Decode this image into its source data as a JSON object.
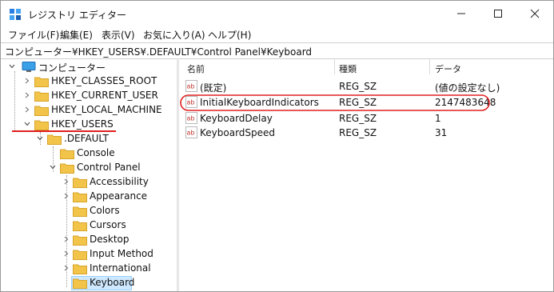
{
  "window": {
    "title": "レジストリ エディター"
  },
  "menu": [
    "ファイル(F)",
    "編集(E)",
    "表示(V)",
    "お気に入り(A)",
    "ヘルプ(H)"
  ],
  "address_bar": {
    "path": "コンピューター¥HKEY_USERS¥.DEFAULT¥Control Panel¥Keyboard"
  },
  "tree": {
    "root": "コンピューター",
    "hives": [
      "HKEY_CLASSES_ROOT",
      "HKEY_CURRENT_USER",
      "HKEY_LOCAL_MACHINE",
      "HKEY_USERS"
    ],
    "users_child": ".DEFAULT",
    "default_children": [
      "Console",
      "Control Panel"
    ],
    "control_panel_children": [
      "Accessibility",
      "Appearance",
      "Colors",
      "Cursors",
      "Desktop",
      "Input Method",
      "International",
      "Keyboard"
    ],
    "selected": "Keyboard"
  },
  "columns": {
    "name": "名前",
    "type": "種類",
    "data": "データ"
  },
  "values": [
    {
      "name": "(既定)",
      "type": "REG_SZ",
      "data": "(値の設定なし)"
    },
    {
      "name": "InitialKeyboardIndicators",
      "type": "REG_SZ",
      "data": "2147483648"
    },
    {
      "name": "KeyboardDelay",
      "type": "REG_SZ",
      "data": "1"
    },
    {
      "name": "KeyboardSpeed",
      "type": "REG_SZ",
      "data": "31"
    }
  ],
  "colors": {
    "annotation": "#e02020",
    "folder": "#f2c54a",
    "selection": "#cde8ff"
  }
}
